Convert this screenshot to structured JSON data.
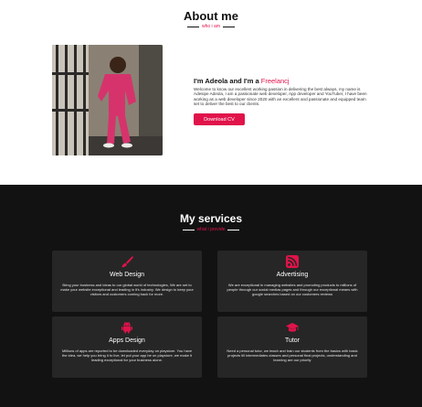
{
  "about": {
    "title": "About me",
    "subtitle": "who i am",
    "intro_prefix": "I'm Adeola and I'm a ",
    "intro_role": "Freelancj",
    "bio": "Welcome to know our excellent working passion in delivering the best always, my name is Adesipe Adeola, I am a passionate web developer, App developer and YouTuber, I have been working as a web developer since 2020 with an excellent and passionate and equipped team set to deliver the best to our clients.",
    "cv_button": "Download CV"
  },
  "services": {
    "title": "My services",
    "subtitle": "what i provide",
    "items": [
      {
        "icon": "paint-brush-icon",
        "title": "Web Design",
        "description": "Bring your business and ideas to our global world of technologies, We are set to make your website exceptional and leading in it's industry. We design to keep your visitors and customers coming back for more."
      },
      {
        "icon": "rss-feed-icon",
        "title": "Advertising",
        "description": "We are exceptional in managing websites and promoting products to millions of people through our social medias pages and through our exceptional means with google searches based on our customers reviews"
      },
      {
        "icon": "android-icon",
        "title": "Apps Design",
        "description": "Millions of apps are reported to be downloaded everyday on playstore. You have the idea, we help you bring it to live, let put your app be on playstore, we make it leading exceptional for your business alone."
      },
      {
        "icon": "graduation-cap-icon",
        "title": "Tutor",
        "description": "Need a personal tutor, we teach and train our students from the basics with basic projects till intermediates classes and personal final projects, understanding and learning are our priority"
      }
    ]
  },
  "colors": {
    "accent": "#e0134a",
    "dark_bg": "#121212",
    "card_bg": "#262626"
  }
}
